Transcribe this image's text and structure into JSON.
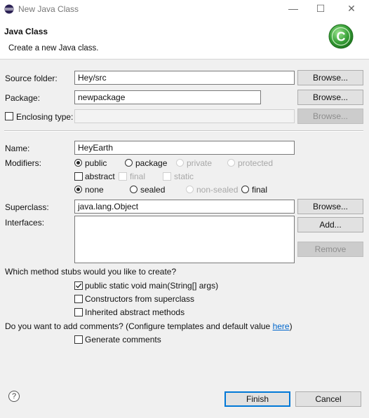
{
  "window": {
    "title": "New Java Class",
    "minimize": "—",
    "maximize": "☐",
    "close": "✕"
  },
  "header": {
    "title": "Java Class",
    "subtitle": "Create a new Java class.",
    "logo_icon": "java-class-logo-icon",
    "logo_letter": "C",
    "logo_color": "#3aa23a"
  },
  "source_folder": {
    "label": "Source folder:",
    "value": "Hey/src",
    "button": "Browse..."
  },
  "package": {
    "label": "Package:",
    "value": "newpackage",
    "button": "Browse..."
  },
  "enclosing": {
    "label": "Enclosing type:",
    "value": "",
    "button": "Browse...",
    "checked": false
  },
  "name": {
    "label": "Name:",
    "value": "HeyEarth"
  },
  "modifiers": {
    "label": "Modifiers:",
    "access": [
      {
        "label": "public",
        "selected": true,
        "enabled": true
      },
      {
        "label": "package",
        "selected": false,
        "enabled": true
      },
      {
        "label": "private",
        "selected": false,
        "enabled": false
      },
      {
        "label": "protected",
        "selected": false,
        "enabled": false
      }
    ],
    "flags": [
      {
        "label": "abstract",
        "checked": false,
        "enabled": true
      },
      {
        "label": "final",
        "checked": false,
        "enabled": false
      },
      {
        "label": "static",
        "checked": false,
        "enabled": false
      }
    ],
    "sealing": [
      {
        "label": "none",
        "selected": true,
        "enabled": true
      },
      {
        "label": "sealed",
        "selected": false,
        "enabled": true
      },
      {
        "label": "non-sealed",
        "selected": false,
        "enabled": false
      },
      {
        "label": "final",
        "selected": false,
        "enabled": true
      }
    ]
  },
  "superclass": {
    "label": "Superclass:",
    "value": "java.lang.Object",
    "button": "Browse..."
  },
  "interfaces": {
    "label": "Interfaces:",
    "add_button": "Add...",
    "remove_button": "Remove"
  },
  "stubs": {
    "question": "Which method stubs would you like to create?",
    "options": [
      {
        "label": "public static void main(String[] args)",
        "checked": true
      },
      {
        "label": "Constructors from superclass",
        "checked": false
      },
      {
        "label": "Inherited abstract methods",
        "checked": false
      }
    ]
  },
  "comments": {
    "question_prefix": "Do you want to add comments? (Configure templates and default value ",
    "link": "here",
    "question_suffix": ")",
    "option": {
      "label": "Generate comments",
      "checked": false
    }
  },
  "footer": {
    "help": "?",
    "finish": "Finish",
    "cancel": "Cancel"
  }
}
